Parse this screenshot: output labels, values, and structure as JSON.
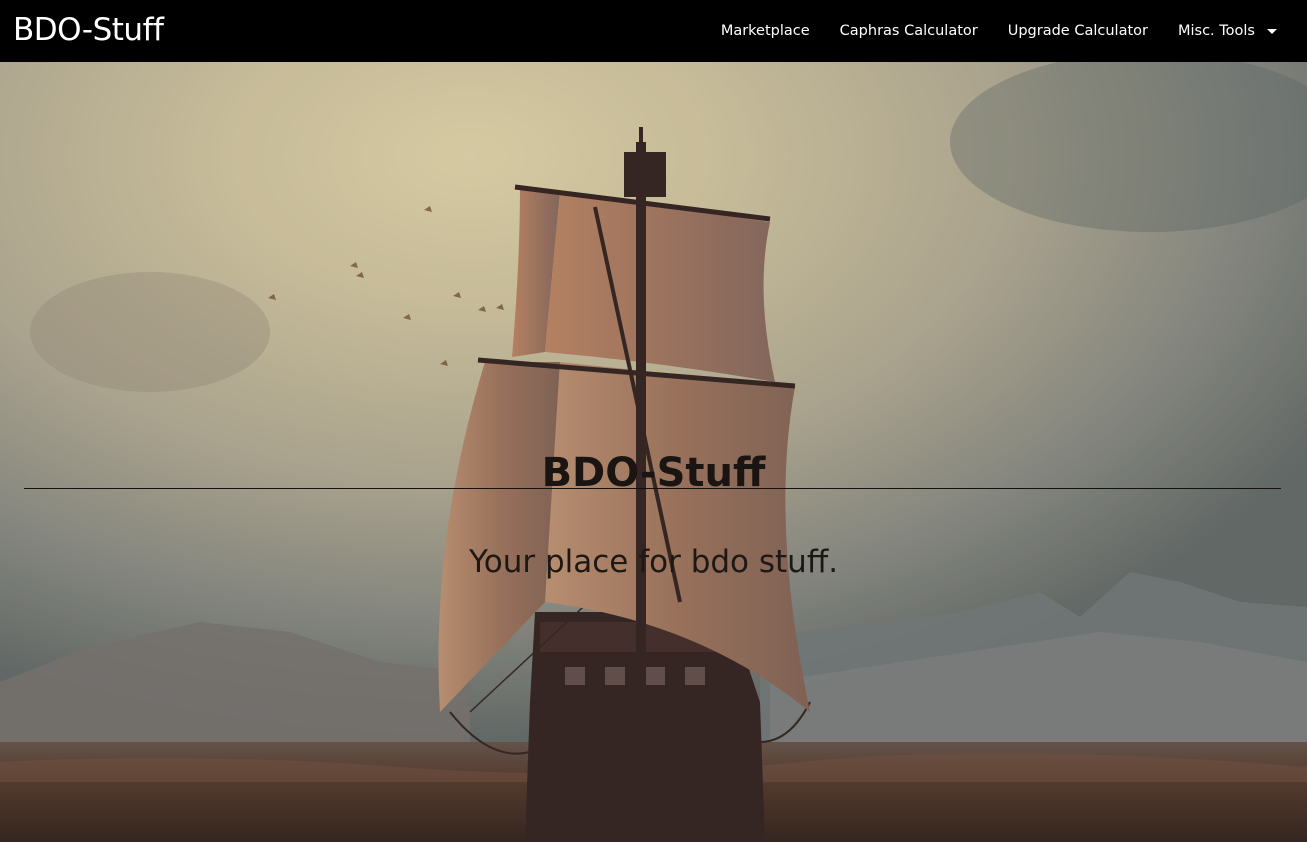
{
  "navbar": {
    "brand": "BDO-Stuff",
    "links": [
      {
        "label": "Marketplace"
      },
      {
        "label": "Caphras Calculator"
      },
      {
        "label": "Upgrade Calculator"
      },
      {
        "label": "Misc. Tools"
      }
    ],
    "dropdown_icon": "caret-down-icon",
    "background_color": "#000000",
    "text_color": "#ffffff"
  },
  "hero": {
    "title": "BDO-Stuff",
    "subtitle": "Your place for bdo stuff.",
    "background_image": "sailing-ship-at-sunset"
  }
}
